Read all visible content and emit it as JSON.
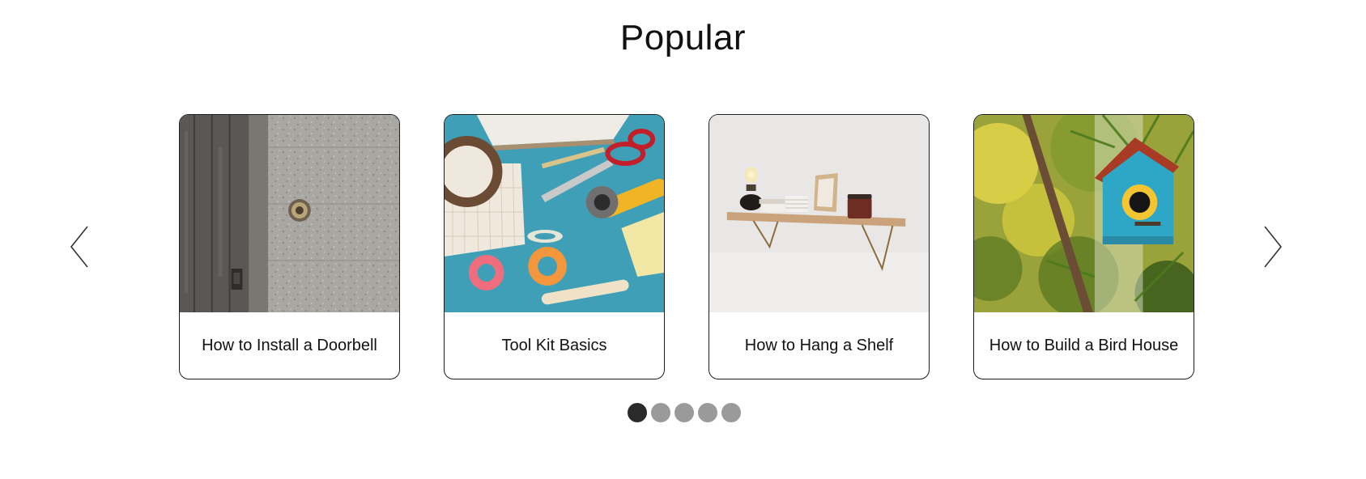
{
  "section": {
    "title": "Popular"
  },
  "carousel": {
    "prev_icon": "chevron-left-icon",
    "next_icon": "chevron-right-icon",
    "cards": [
      {
        "label": "How to Install a Doorbell",
        "image": "doorbell-photo"
      },
      {
        "label": "Tool Kit Basics",
        "image": "tool-kit-photo"
      },
      {
        "label": "How to Hang a Shelf",
        "image": "shelf-photo"
      },
      {
        "label": "How to Build a Bird House",
        "image": "bird-house-photo"
      }
    ],
    "dots": {
      "count": 5,
      "active_index": 0
    }
  },
  "colors": {
    "dot_active": "#2a2a2a",
    "dot_inactive": "#9a9a9a",
    "card_border": "#1e1e1e"
  }
}
